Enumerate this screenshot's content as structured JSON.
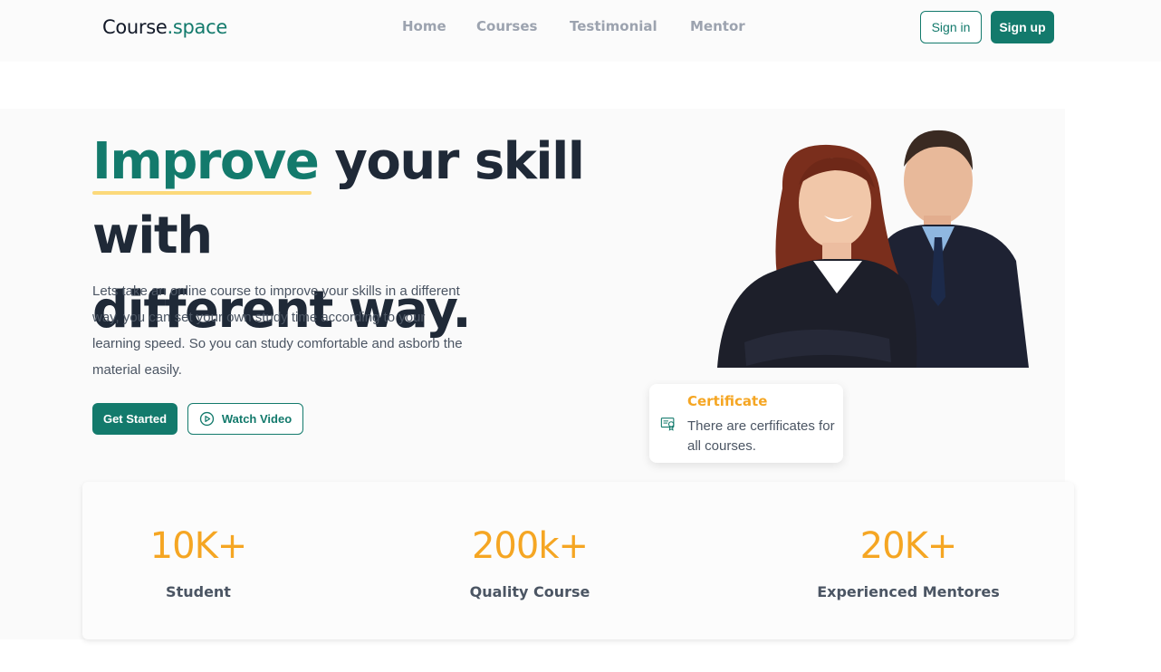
{
  "brand": {
    "name_part1": "Course",
    "name_part2": ".space"
  },
  "nav": {
    "links": [
      "Home",
      "Courses",
      "Testimonial",
      "Mentor"
    ],
    "sign_in": "Sign in",
    "sign_up": "Sign up"
  },
  "hero": {
    "headline_highlight": "Improve",
    "headline_rest_line1": " your skill with",
    "headline_line2": "different way.",
    "description": "Lets take an online course to improve your skills in a different way, you can set your own study time according to your learning speed. So you can study comfortable and asborb the material easily.",
    "cta_primary": "Get Started",
    "cta_secondary": "Watch Video",
    "cta_secondary_icon": "play-circle-icon"
  },
  "certificate_card": {
    "title": "Certificate",
    "text": "There are cerfificates for all courses.",
    "icon": "certificate-icon"
  },
  "stats": [
    {
      "value": "10K+",
      "label": "Student"
    },
    {
      "value": "200k+",
      "label": "Quality Course"
    },
    {
      "value": "20K+",
      "label": "Experienced Mentores"
    }
  ],
  "colors": {
    "primary": "#137a6c",
    "accent_orange": "#f5a623",
    "underline_yellow": "#fcd97a",
    "nav_text": "#9ca3af",
    "heading_text": "#1f2937"
  }
}
